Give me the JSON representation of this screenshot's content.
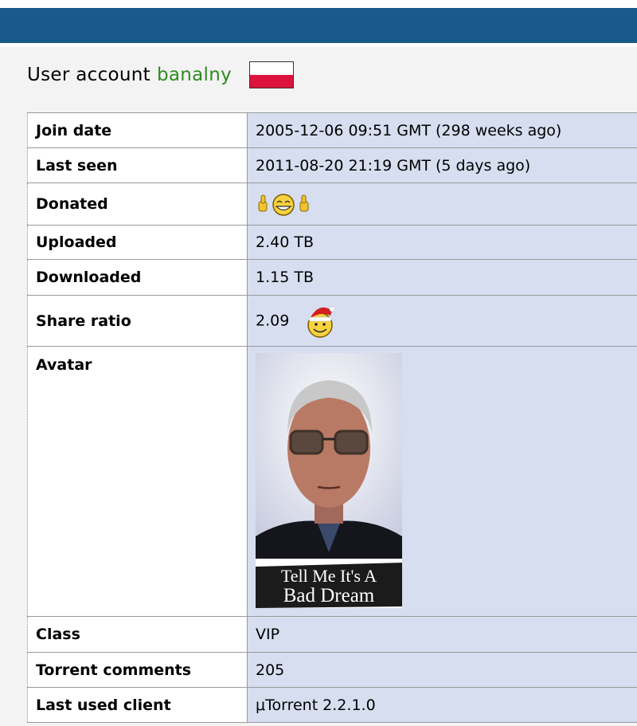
{
  "page": {
    "title_prefix": "User account",
    "username": "banalny",
    "flag": "poland-flag"
  },
  "rows": [
    {
      "label": "Join date",
      "value": "2005-12-06 09:51 GMT (298 weeks ago)"
    },
    {
      "label": "Last seen",
      "value": "2011-08-20 21:19 GMT (5 days ago)"
    },
    {
      "label": "Donated",
      "icon": "thumbs-up-smiley-icon"
    },
    {
      "label": "Uploaded",
      "value": "2.40 TB"
    },
    {
      "label": "Downloaded",
      "value": "1.15 TB"
    },
    {
      "label": "Share ratio",
      "value": "2.09",
      "icon": "santa-hat-smiley-icon"
    },
    {
      "label": "Avatar",
      "avatar_text_line1": "Tell Me It's A",
      "avatar_text_line2": "Bad Dream"
    },
    {
      "label": "Class",
      "value": "VIP"
    },
    {
      "label": "Torrent comments",
      "value": "205"
    },
    {
      "label": "Last used client",
      "value": "μTorrent 2.2.1.0"
    }
  ],
  "colors": {
    "header": "#1a5a8a",
    "username": "#2e8b1e",
    "value_cell": "#d6def0"
  }
}
